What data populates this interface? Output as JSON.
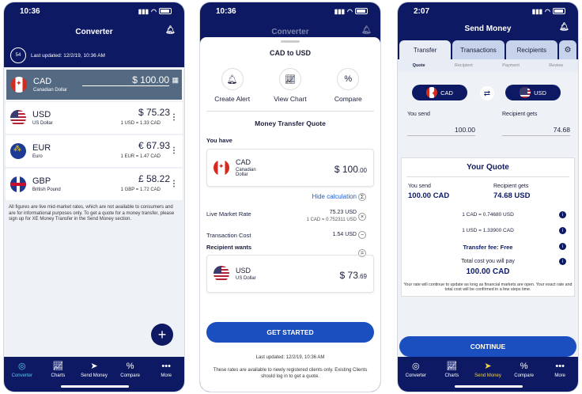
{
  "phone1": {
    "time": "10:36",
    "title": "Converter",
    "badge": "54",
    "last_updated": "Last updated: 12/2/19, 10:36 AM",
    "base": {
      "code": "CAD",
      "name": "Canadian Dollar",
      "amount": "$ 100.00"
    },
    "rows": [
      {
        "code": "USD",
        "name": "US Dollar",
        "amount": "$ 75.23",
        "rate": "1 USD = 1.33 CAD"
      },
      {
        "code": "EUR",
        "name": "Euro",
        "amount": "€ 67.93",
        "rate": "1 EUR = 1.47 CAD"
      },
      {
        "code": "GBP",
        "name": "British Pound",
        "amount": "£ 58.22",
        "rate": "1 GBP = 1.72 CAD"
      }
    ],
    "disclaimer": "All figures are live mid-market rates, which are not available to consumers and are for informational purposes only. To get a quote for a money transfer, please sign up for XE Money Transfer in the Send Money section.",
    "fab": "+"
  },
  "tabs": [
    "Converter",
    "Charts",
    "Send Money",
    "Compare",
    "More"
  ],
  "tab_icons": [
    "coins-icon",
    "chart-icon",
    "send-icon",
    "percent-icon",
    "more-icon"
  ],
  "phone2": {
    "time": "10:36",
    "title": "Converter",
    "sheet_title": "CAD to USD",
    "actions": [
      "Create Alert",
      "View Chart",
      "Compare"
    ],
    "quote_title": "Money Transfer Quote",
    "you_have_label": "You have",
    "have": {
      "code": "CAD",
      "name": "Canadian Dollar",
      "amount": "$ 100",
      "cents": ".00"
    },
    "hide_calc": "Hide calculation",
    "live_rate_label": "Live Market Rate",
    "live_rate_value": "75.23 USD",
    "live_rate_sub": "1 CAD = 0.752311 USD",
    "tx_cost_label": "Transaction Cost",
    "tx_cost_value": "1.54 USD",
    "recipient_wants_label": "Recipient wants",
    "wants": {
      "code": "USD",
      "name": "US Dollar",
      "amount": "$ 73",
      "cents": ".69"
    },
    "cta": "GET STARTED",
    "last_updated": "Last updated: 12/2/19, 10:36 AM",
    "footnote": "These rates are available to newly registered clients only. Existing Clients should log in to get a quote."
  },
  "phone3": {
    "time": "2:07",
    "title": "Send Money",
    "tabs": [
      "Transfer",
      "Transactions",
      "Recipients"
    ],
    "steps": [
      "Quote",
      "Recipient",
      "Payment",
      "Review"
    ],
    "from": "CAD",
    "to": "USD",
    "you_send_label": "You send",
    "you_send_value": "100.00",
    "recipient_gets_label": "Recipient gets",
    "recipient_gets_value": "74.68",
    "quote_title": "Your Quote",
    "q_send_label": "You send",
    "q_send_value": "100.00 CAD",
    "q_gets_label": "Recipient gets",
    "q_gets_value": "74.68 USD",
    "rate1": "1 CAD = 0.74680 USD",
    "rate2": "1 USD = 1.33900 CAD",
    "fee": "Transfer fee: Free",
    "total_label": "Total cost you will pay",
    "total_value": "100.00 CAD",
    "fine_print": "Your rate will continue to update as long as financial markets are open. Your exact rate and total cost will be confirmed in a few steps time.",
    "cta": "CONTINUE"
  }
}
